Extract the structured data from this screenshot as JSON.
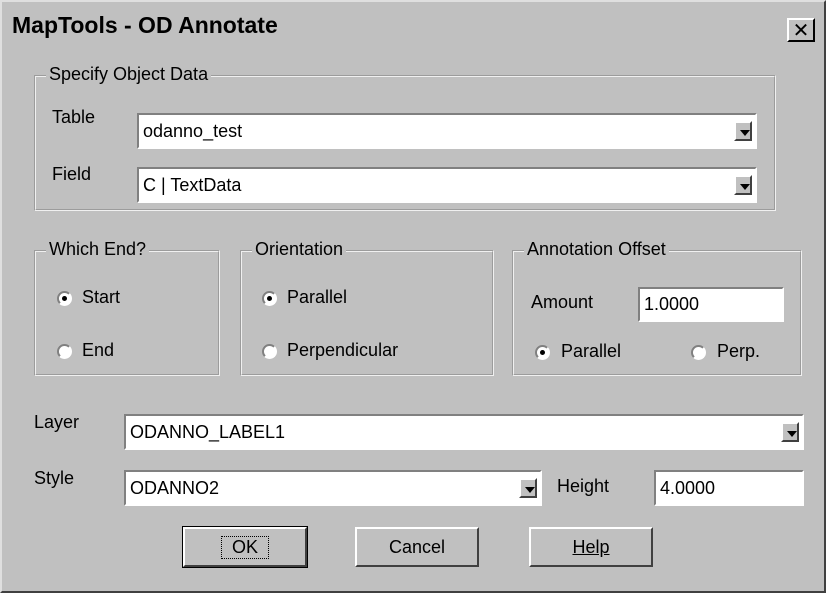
{
  "window": {
    "title": "MapTools - OD Annotate",
    "close_symbol": "✕"
  },
  "object_data": {
    "legend": "Specify Object Data",
    "table_label": "Table",
    "table_value": "odanno_test",
    "field_label": "Field",
    "field_value": "C | TextData"
  },
  "which_end": {
    "legend": "Which End?",
    "options": [
      "Start",
      "End"
    ],
    "selected": "Start"
  },
  "orientation": {
    "legend": "Orientation",
    "options": [
      "Parallel",
      "Perpendicular"
    ],
    "selected": "Parallel"
  },
  "annotation_offset": {
    "legend": "Annotation Offset",
    "amount_label": "Amount",
    "amount_value": "1.0000",
    "options": [
      "Parallel",
      "Perp."
    ],
    "selected": "Parallel"
  },
  "layer": {
    "label": "Layer",
    "value": "ODANNO_LABEL1"
  },
  "style": {
    "label": "Style",
    "value": "ODANNO2"
  },
  "height": {
    "label": "Height",
    "value": "4.0000"
  },
  "buttons": {
    "ok": "OK",
    "cancel": "Cancel",
    "help": "Help"
  }
}
